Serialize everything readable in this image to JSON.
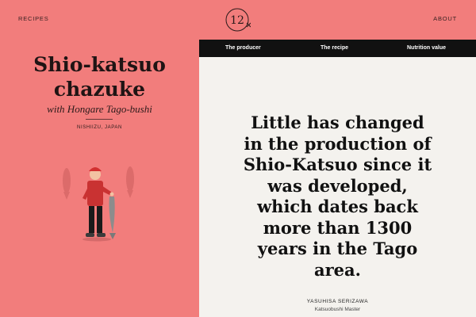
{
  "nav": {
    "recipes_label": "RECIPES",
    "about_label": "ABOUT",
    "logo_number": "12"
  },
  "recipe": {
    "title_line1": "Shio-katsuo",
    "title_line2": "chazuke",
    "subtitle": "with Hongare Tago-bushi",
    "location": "NISHIIZU, JAPAN"
  },
  "tabs": [
    {
      "label": "The producer"
    },
    {
      "label": "The recipe"
    },
    {
      "label": "Nutrition value"
    }
  ],
  "quote": {
    "lines": [
      "Little has changed",
      "in the production of",
      "Shio-Katsuo since it",
      "was developed,",
      "which dates back",
      "more than 1300",
      "years in the Tago",
      "area."
    ],
    "author_name": "YASUHISA SERIZAWA",
    "author_role": "Katsuobushi Master"
  },
  "colors": {
    "background": "#f27d7c",
    "panel": "#f4f2ee",
    "tab_bar": "#111111",
    "text_dark": "#1f1414"
  },
  "icons": {
    "logo": "logo-emblem-icon",
    "illustration": "fisherman-illustration"
  }
}
